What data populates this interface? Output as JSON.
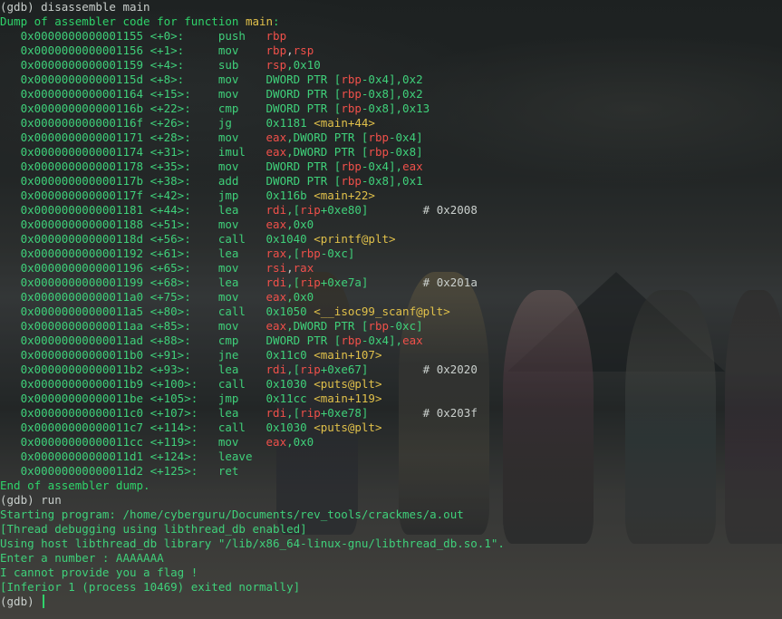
{
  "colors": {
    "default": "#c9cfcc",
    "prompt": "#c9cfcc",
    "heading": "#2fd36a",
    "address": "#3fd07a",
    "offset": "#3fd07a",
    "mnemonic": "#3fd07a",
    "register": "#f0504a",
    "number": "#3fd07a",
    "function": "#e0c04a",
    "symbol": "#e0c04a",
    "comment": "#c9cfcc",
    "output": "#3fd07a",
    "path": "#3fd07a"
  },
  "lines": [
    [
      {
        "t": "(gdb) disassemble main",
        "c": "prompt"
      }
    ],
    [
      {
        "t": "Dump of assembler code for function ",
        "c": "heading"
      },
      {
        "t": "main",
        "c": "function"
      },
      {
        "t": ":",
        "c": "heading"
      }
    ],
    [
      {
        "t": "   0x0000000000001155 ",
        "c": "address"
      },
      {
        "t": "<+0>:     ",
        "c": "offset"
      },
      {
        "t": "push   ",
        "c": "mnemonic"
      },
      {
        "t": "rbp",
        "c": "register"
      }
    ],
    [
      {
        "t": "   0x0000000000001156 ",
        "c": "address"
      },
      {
        "t": "<+1>:     ",
        "c": "offset"
      },
      {
        "t": "mov    ",
        "c": "mnemonic"
      },
      {
        "t": "rbp",
        "c": "register"
      },
      {
        "t": ",",
        "c": "default"
      },
      {
        "t": "rsp",
        "c": "register"
      }
    ],
    [
      {
        "t": "   0x0000000000001159 ",
        "c": "address"
      },
      {
        "t": "<+4>:     ",
        "c": "offset"
      },
      {
        "t": "sub    ",
        "c": "mnemonic"
      },
      {
        "t": "rsp",
        "c": "register"
      },
      {
        "t": ",0x10",
        "c": "number"
      }
    ],
    [
      {
        "t": "   0x000000000000115d ",
        "c": "address"
      },
      {
        "t": "<+8>:     ",
        "c": "offset"
      },
      {
        "t": "mov    ",
        "c": "mnemonic"
      },
      {
        "t": "DWORD PTR [",
        "c": "number"
      },
      {
        "t": "rbp",
        "c": "register"
      },
      {
        "t": "-0x4],0x2",
        "c": "number"
      }
    ],
    [
      {
        "t": "   0x0000000000001164 ",
        "c": "address"
      },
      {
        "t": "<+15>:    ",
        "c": "offset"
      },
      {
        "t": "mov    ",
        "c": "mnemonic"
      },
      {
        "t": "DWORD PTR [",
        "c": "number"
      },
      {
        "t": "rbp",
        "c": "register"
      },
      {
        "t": "-0x8],0x2",
        "c": "number"
      }
    ],
    [
      {
        "t": "   0x000000000000116b ",
        "c": "address"
      },
      {
        "t": "<+22>:    ",
        "c": "offset"
      },
      {
        "t": "cmp    ",
        "c": "mnemonic"
      },
      {
        "t": "DWORD PTR [",
        "c": "number"
      },
      {
        "t": "rbp",
        "c": "register"
      },
      {
        "t": "-0x8],0x13",
        "c": "number"
      }
    ],
    [
      {
        "t": "   0x000000000000116f ",
        "c": "address"
      },
      {
        "t": "<+26>:    ",
        "c": "offset"
      },
      {
        "t": "jg     ",
        "c": "mnemonic"
      },
      {
        "t": "0x1181 ",
        "c": "number"
      },
      {
        "t": "<main+44>",
        "c": "symbol"
      }
    ],
    [
      {
        "t": "   0x0000000000001171 ",
        "c": "address"
      },
      {
        "t": "<+28>:    ",
        "c": "offset"
      },
      {
        "t": "mov    ",
        "c": "mnemonic"
      },
      {
        "t": "eax",
        "c": "register"
      },
      {
        "t": ",DWORD PTR [",
        "c": "number"
      },
      {
        "t": "rbp",
        "c": "register"
      },
      {
        "t": "-0x4]",
        "c": "number"
      }
    ],
    [
      {
        "t": "   0x0000000000001174 ",
        "c": "address"
      },
      {
        "t": "<+31>:    ",
        "c": "offset"
      },
      {
        "t": "imul   ",
        "c": "mnemonic"
      },
      {
        "t": "eax",
        "c": "register"
      },
      {
        "t": ",DWORD PTR [",
        "c": "number"
      },
      {
        "t": "rbp",
        "c": "register"
      },
      {
        "t": "-0x8]",
        "c": "number"
      }
    ],
    [
      {
        "t": "   0x0000000000001178 ",
        "c": "address"
      },
      {
        "t": "<+35>:    ",
        "c": "offset"
      },
      {
        "t": "mov    ",
        "c": "mnemonic"
      },
      {
        "t": "DWORD PTR [",
        "c": "number"
      },
      {
        "t": "rbp",
        "c": "register"
      },
      {
        "t": "-0x4],",
        "c": "number"
      },
      {
        "t": "eax",
        "c": "register"
      }
    ],
    [
      {
        "t": "   0x000000000000117b ",
        "c": "address"
      },
      {
        "t": "<+38>:    ",
        "c": "offset"
      },
      {
        "t": "add    ",
        "c": "mnemonic"
      },
      {
        "t": "DWORD PTR [",
        "c": "number"
      },
      {
        "t": "rbp",
        "c": "register"
      },
      {
        "t": "-0x8],0x1",
        "c": "number"
      }
    ],
    [
      {
        "t": "   0x000000000000117f ",
        "c": "address"
      },
      {
        "t": "<+42>:    ",
        "c": "offset"
      },
      {
        "t": "jmp    ",
        "c": "mnemonic"
      },
      {
        "t": "0x116b ",
        "c": "number"
      },
      {
        "t": "<main+22>",
        "c": "symbol"
      }
    ],
    [
      {
        "t": "   0x0000000000001181 ",
        "c": "address"
      },
      {
        "t": "<+44>:    ",
        "c": "offset"
      },
      {
        "t": "lea    ",
        "c": "mnemonic"
      },
      {
        "t": "rdi",
        "c": "register"
      },
      {
        "t": ",[",
        "c": "number"
      },
      {
        "t": "rip",
        "c": "register"
      },
      {
        "t": "+0xe80]",
        "c": "number"
      },
      {
        "t": "        # 0x2008",
        "c": "comment"
      }
    ],
    [
      {
        "t": "   0x0000000000001188 ",
        "c": "address"
      },
      {
        "t": "<+51>:    ",
        "c": "offset"
      },
      {
        "t": "mov    ",
        "c": "mnemonic"
      },
      {
        "t": "eax",
        "c": "register"
      },
      {
        "t": ",0x0",
        "c": "number"
      }
    ],
    [
      {
        "t": "   0x000000000000118d ",
        "c": "address"
      },
      {
        "t": "<+56>:    ",
        "c": "offset"
      },
      {
        "t": "call   ",
        "c": "mnemonic"
      },
      {
        "t": "0x1040 ",
        "c": "number"
      },
      {
        "t": "<printf@plt>",
        "c": "symbol"
      }
    ],
    [
      {
        "t": "   0x0000000000001192 ",
        "c": "address"
      },
      {
        "t": "<+61>:    ",
        "c": "offset"
      },
      {
        "t": "lea    ",
        "c": "mnemonic"
      },
      {
        "t": "rax",
        "c": "register"
      },
      {
        "t": ",[",
        "c": "number"
      },
      {
        "t": "rbp",
        "c": "register"
      },
      {
        "t": "-0xc]",
        "c": "number"
      }
    ],
    [
      {
        "t": "   0x0000000000001196 ",
        "c": "address"
      },
      {
        "t": "<+65>:    ",
        "c": "offset"
      },
      {
        "t": "mov    ",
        "c": "mnemonic"
      },
      {
        "t": "rsi",
        "c": "register"
      },
      {
        "t": ",",
        "c": "default"
      },
      {
        "t": "rax",
        "c": "register"
      }
    ],
    [
      {
        "t": "   0x0000000000001199 ",
        "c": "address"
      },
      {
        "t": "<+68>:    ",
        "c": "offset"
      },
      {
        "t": "lea    ",
        "c": "mnemonic"
      },
      {
        "t": "rdi",
        "c": "register"
      },
      {
        "t": ",[",
        "c": "number"
      },
      {
        "t": "rip",
        "c": "register"
      },
      {
        "t": "+0xe7a]",
        "c": "number"
      },
      {
        "t": "        # 0x201a",
        "c": "comment"
      }
    ],
    [
      {
        "t": "   0x00000000000011a0 ",
        "c": "address"
      },
      {
        "t": "<+75>:    ",
        "c": "offset"
      },
      {
        "t": "mov    ",
        "c": "mnemonic"
      },
      {
        "t": "eax",
        "c": "register"
      },
      {
        "t": ",0x0",
        "c": "number"
      }
    ],
    [
      {
        "t": "   0x00000000000011a5 ",
        "c": "address"
      },
      {
        "t": "<+80>:    ",
        "c": "offset"
      },
      {
        "t": "call   ",
        "c": "mnemonic"
      },
      {
        "t": "0x1050 ",
        "c": "number"
      },
      {
        "t": "<__isoc99_scanf@plt>",
        "c": "symbol"
      }
    ],
    [
      {
        "t": "   0x00000000000011aa ",
        "c": "address"
      },
      {
        "t": "<+85>:    ",
        "c": "offset"
      },
      {
        "t": "mov    ",
        "c": "mnemonic"
      },
      {
        "t": "eax",
        "c": "register"
      },
      {
        "t": ",DWORD PTR [",
        "c": "number"
      },
      {
        "t": "rbp",
        "c": "register"
      },
      {
        "t": "-0xc]",
        "c": "number"
      }
    ],
    [
      {
        "t": "   0x00000000000011ad ",
        "c": "address"
      },
      {
        "t": "<+88>:    ",
        "c": "offset"
      },
      {
        "t": "cmp    ",
        "c": "mnemonic"
      },
      {
        "t": "DWORD PTR [",
        "c": "number"
      },
      {
        "t": "rbp",
        "c": "register"
      },
      {
        "t": "-0x4],",
        "c": "number"
      },
      {
        "t": "eax",
        "c": "register"
      }
    ],
    [
      {
        "t": "   0x00000000000011b0 ",
        "c": "address"
      },
      {
        "t": "<+91>:    ",
        "c": "offset"
      },
      {
        "t": "jne    ",
        "c": "mnemonic"
      },
      {
        "t": "0x11c0 ",
        "c": "number"
      },
      {
        "t": "<main+107>",
        "c": "symbol"
      }
    ],
    [
      {
        "t": "   0x00000000000011b2 ",
        "c": "address"
      },
      {
        "t": "<+93>:    ",
        "c": "offset"
      },
      {
        "t": "lea    ",
        "c": "mnemonic"
      },
      {
        "t": "rdi",
        "c": "register"
      },
      {
        "t": ",[",
        "c": "number"
      },
      {
        "t": "rip",
        "c": "register"
      },
      {
        "t": "+0xe67]",
        "c": "number"
      },
      {
        "t": "        # 0x2020",
        "c": "comment"
      }
    ],
    [
      {
        "t": "   0x00000000000011b9 ",
        "c": "address"
      },
      {
        "t": "<+100>:   ",
        "c": "offset"
      },
      {
        "t": "call   ",
        "c": "mnemonic"
      },
      {
        "t": "0x1030 ",
        "c": "number"
      },
      {
        "t": "<puts@plt>",
        "c": "symbol"
      }
    ],
    [
      {
        "t": "   0x00000000000011be ",
        "c": "address"
      },
      {
        "t": "<+105>:   ",
        "c": "offset"
      },
      {
        "t": "jmp    ",
        "c": "mnemonic"
      },
      {
        "t": "0x11cc ",
        "c": "number"
      },
      {
        "t": "<main+119>",
        "c": "symbol"
      }
    ],
    [
      {
        "t": "   0x00000000000011c0 ",
        "c": "address"
      },
      {
        "t": "<+107>:   ",
        "c": "offset"
      },
      {
        "t": "lea    ",
        "c": "mnemonic"
      },
      {
        "t": "rdi",
        "c": "register"
      },
      {
        "t": ",[",
        "c": "number"
      },
      {
        "t": "rip",
        "c": "register"
      },
      {
        "t": "+0xe78]",
        "c": "number"
      },
      {
        "t": "        # 0x203f",
        "c": "comment"
      }
    ],
    [
      {
        "t": "   0x00000000000011c7 ",
        "c": "address"
      },
      {
        "t": "<+114>:   ",
        "c": "offset"
      },
      {
        "t": "call   ",
        "c": "mnemonic"
      },
      {
        "t": "0x1030 ",
        "c": "number"
      },
      {
        "t": "<puts@plt>",
        "c": "symbol"
      }
    ],
    [
      {
        "t": "   0x00000000000011cc ",
        "c": "address"
      },
      {
        "t": "<+119>:   ",
        "c": "offset"
      },
      {
        "t": "mov    ",
        "c": "mnemonic"
      },
      {
        "t": "eax",
        "c": "register"
      },
      {
        "t": ",0x0",
        "c": "number"
      }
    ],
    [
      {
        "t": "   0x00000000000011d1 ",
        "c": "address"
      },
      {
        "t": "<+124>:   ",
        "c": "offset"
      },
      {
        "t": "leave",
        "c": "mnemonic"
      }
    ],
    [
      {
        "t": "   0x00000000000011d2 ",
        "c": "address"
      },
      {
        "t": "<+125>:   ",
        "c": "offset"
      },
      {
        "t": "ret",
        "c": "mnemonic"
      }
    ],
    [
      {
        "t": "End of assembler dump.",
        "c": "heading"
      }
    ],
    [
      {
        "t": "(gdb) run",
        "c": "prompt"
      }
    ],
    [
      {
        "t": "Starting program: ",
        "c": "output"
      },
      {
        "t": "/home/cyberguru/Documents/rev_tools/crackmes/a.out",
        "c": "path"
      }
    ],
    [
      {
        "t": "[Thread debugging using libthread_db enabled]",
        "c": "output"
      }
    ],
    [
      {
        "t": "Using host libthread_db library \"/lib/x86_64-linux-gnu/libthread_db.so.1\".",
        "c": "output"
      }
    ],
    [
      {
        "t": "Enter a number : AAAAAAA",
        "c": "output"
      }
    ],
    [
      {
        "t": "I cannot provide you a flag !",
        "c": "output"
      }
    ],
    [
      {
        "t": "[Inferior 1 (process 10469) exited normally]",
        "c": "output"
      }
    ],
    [
      {
        "t": "(gdb) ",
        "c": "prompt"
      }
    ]
  ]
}
